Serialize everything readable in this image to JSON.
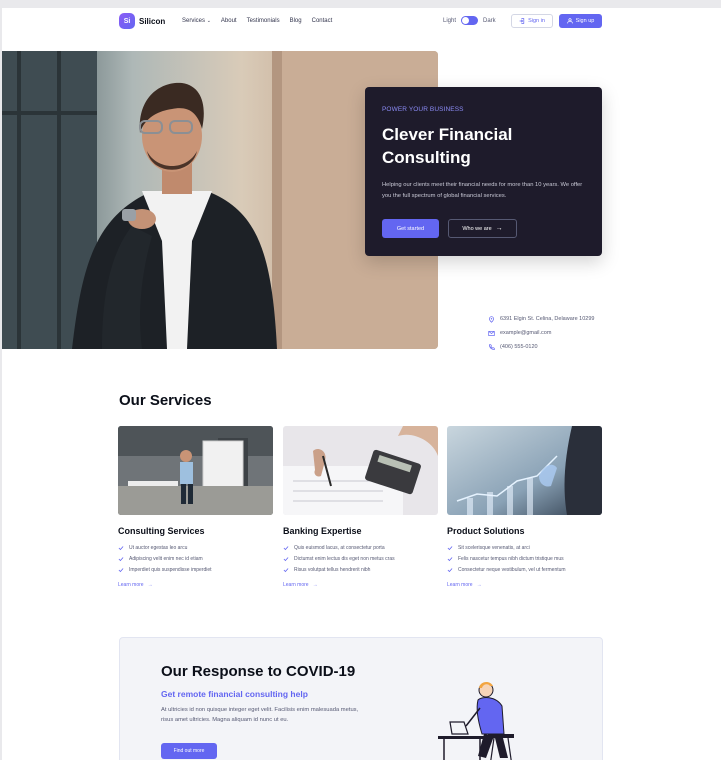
{
  "brand": {
    "logo_mark": "Si",
    "name": "Silicon",
    "accent": "#6366f1",
    "dark": "#1e1b2b"
  },
  "nav": {
    "links": [
      "Services",
      "About",
      "Testimonials",
      "Blog",
      "Contact"
    ],
    "theme_light": "Light",
    "theme_dark": "Dark",
    "signin": "Sign in",
    "signup": "Sign up"
  },
  "hero": {
    "eyebrow": "POWER YOUR BUSINESS",
    "title": "Clever Financial Consulting",
    "description": "Helping our clients meet their financial needs for more than 10 years. We offer you  the full spectrum of global financial services.",
    "primary_button": "Get started",
    "secondary_button": "Who we are"
  },
  "contacts": {
    "address": "6391 Elgin St. Celina, Delaware 10299",
    "email": "example@gmail.com",
    "phone": "(406) 555-0120"
  },
  "services": {
    "title": "Our Services",
    "items": [
      {
        "title": "Consulting Services",
        "bullets": [
          "Ut auctor egestas leo arcu",
          "Adipiscing velit enim nec id etiam",
          "Imperdiet quis suspendisse imperdiet"
        ],
        "link": "Learn more"
      },
      {
        "title": "Banking Expertise",
        "bullets": [
          "Quis euismod lacus, at consectetur porta",
          "Dictumst enim lectus dis eget non metus cras",
          "Risus volutpat tellus hendrerit nibh"
        ],
        "link": "Learn more"
      },
      {
        "title": "Product Solutions",
        "bullets": [
          "Sit scelerisque venenatis, at arci",
          "Felis nascetur tempus nibh dictum tristique mus",
          "Consectetur neque vestibulum, vel ut fermentum"
        ],
        "link": "Learn more"
      }
    ]
  },
  "covid": {
    "title": "Our Response to COVID-19",
    "subtitle": "Get remote financial consulting help",
    "description": "At ultricies id non quisque integer eget velit. Facilisis enim malesuada metus, risus amet ultricies. Magna aliquam id nunc ut eu.",
    "button": "Find out more"
  }
}
